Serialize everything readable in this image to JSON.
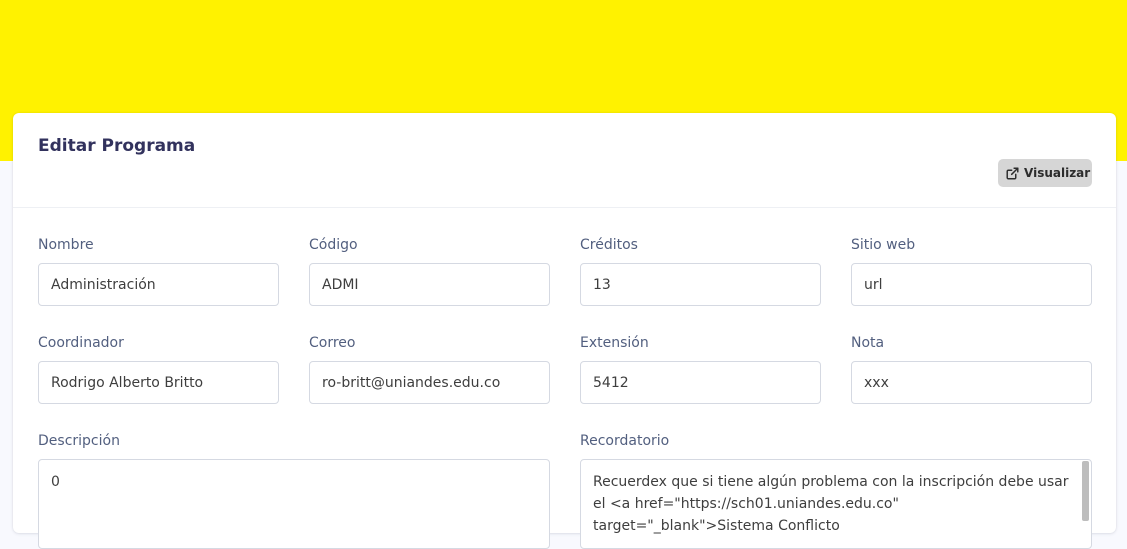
{
  "card": {
    "title": "Editar Programa",
    "visualizar_label": "Visualizar"
  },
  "fields": {
    "nombre": {
      "label": "Nombre",
      "value": "Administración"
    },
    "codigo": {
      "label": "Código",
      "value": "ADMI"
    },
    "creditos": {
      "label": "Créditos",
      "value": "13"
    },
    "sitio_web": {
      "label": "Sitio web",
      "value": "url"
    },
    "coordinador": {
      "label": "Coordinador",
      "value": "Rodrigo Alberto Britto"
    },
    "correo": {
      "label": "Correo",
      "value": "ro-britt@uniandes.edu.co"
    },
    "extension": {
      "label": "Extensión",
      "value": "5412"
    },
    "nota": {
      "label": "Nota",
      "value": "xxx"
    },
    "descripcion": {
      "label": "Descripción",
      "value": "0"
    },
    "recordatorio": {
      "label": "Recordatorio",
      "value": "Recuerdex que si tiene algún problema con la inscripción debe usar el <a href=\"https://sch01.uniandes.edu.co\" target=\"_blank\">Sistema Conflicto"
    }
  },
  "colors": {
    "header_band": "#fff200",
    "page_background": "#f8f9fe",
    "button_background": "#d6d6d6"
  },
  "icons": {
    "visualizar": "external-link-icon"
  }
}
